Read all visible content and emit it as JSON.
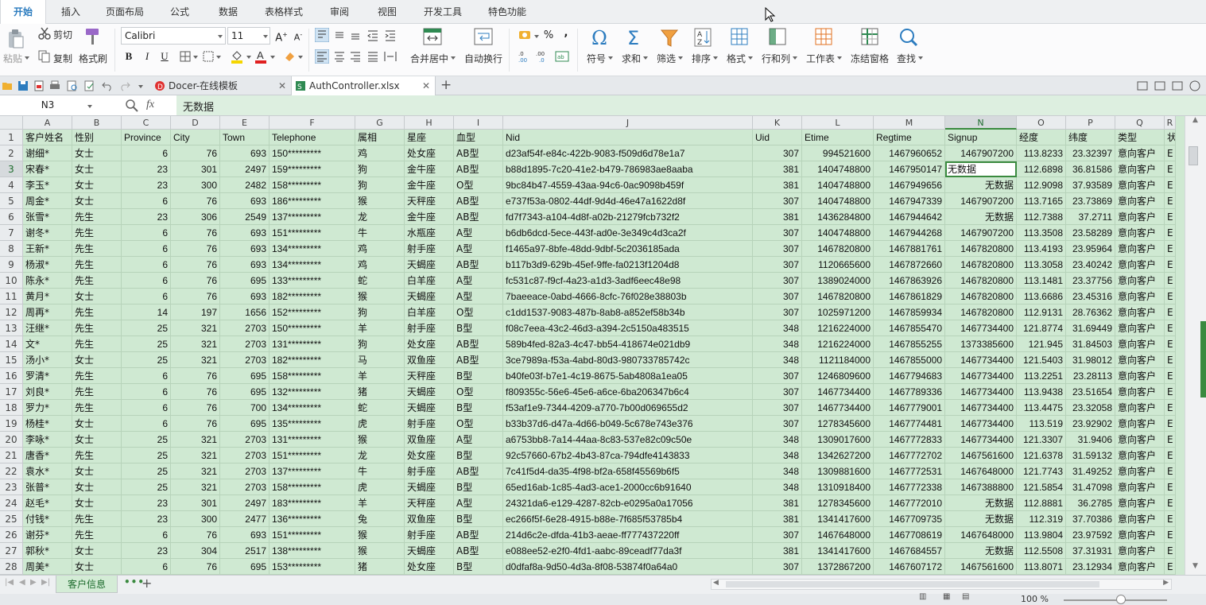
{
  "ribbon_tabs": [
    "开始",
    "插入",
    "页面布局",
    "公式",
    "数据",
    "表格样式",
    "审阅",
    "视图",
    "开发工具",
    "特色功能"
  ],
  "clipboard": {
    "paste": "粘贴",
    "cut": "剪切",
    "copy": "复制",
    "format_painter": "格式刷"
  },
  "font": {
    "name": "Calibri",
    "size": "11"
  },
  "align": {
    "merge_center": "合并居中",
    "wrap": "自动换行"
  },
  "number": {
    "percent": "%",
    "thousands": ","
  },
  "tools": {
    "symbol": "符号",
    "sum": "求和",
    "filter": "筛选",
    "sort": "排序",
    "format": "格式",
    "rows_cols": "行和列",
    "sheet": "工作表",
    "freeze": "冻结窗格",
    "find": "查找"
  },
  "doc_tabs": [
    "Docer-在线模板",
    "AuthController.xlsx"
  ],
  "formula_bar": {
    "cell_ref": "N3",
    "fx": "fx",
    "value": "无数据"
  },
  "columns": [
    "A",
    "B",
    "C",
    "D",
    "E",
    "F",
    "G",
    "H",
    "I",
    "J",
    "K",
    "L",
    "M",
    "N",
    "O",
    "P",
    "Q",
    "R"
  ],
  "header_row": [
    "客户姓名",
    "性别",
    "Province",
    "City",
    "Town",
    "Telephone",
    "属相",
    "星座",
    "血型",
    "Nid",
    "Uid",
    "Etime",
    "Regtime",
    "Signup",
    "经度",
    "纬度",
    "类型",
    "状"
  ],
  "rows": [
    [
      "谢细*",
      "女士",
      "6",
      "76",
      "693",
      "150*********",
      "鸡",
      "处女座",
      "AB型",
      "d23af54f-e84c-422b-9083-f509d6d78e1a7",
      "307",
      "994521600",
      "1467960652",
      "1467907200",
      "113.8233",
      "23.32397",
      "意向客户",
      "E"
    ],
    [
      "宋春*",
      "女士",
      "23",
      "301",
      "2497",
      "159*********",
      "狗",
      "金牛座",
      "AB型",
      "b88d1895-7c20-41e2-b479-786983ae8aaba",
      "381",
      "1404748800",
      "1467950147",
      "无数据",
      "112.6898",
      "36.81586",
      "意向客户",
      "E"
    ],
    [
      "李玉*",
      "女士",
      "23",
      "300",
      "2482",
      "158*********",
      "狗",
      "金牛座",
      "O型",
      "9bc84b47-4559-43aa-94c6-0ac9098b459f",
      "381",
      "1404748800",
      "1467949656",
      "无数据",
      "112.9098",
      "37.93589",
      "意向客户",
      "E"
    ],
    [
      "周金*",
      "女士",
      "6",
      "76",
      "693",
      "186*********",
      "猴",
      "天秤座",
      "AB型",
      "e737f53a-0802-44df-9d4d-46e47a1622d8f",
      "307",
      "1404748800",
      "1467947339",
      "1467907200",
      "113.7165",
      "23.73869",
      "意向客户",
      "E"
    ],
    [
      "张雪*",
      "先生",
      "23",
      "306",
      "2549",
      "137*********",
      "龙",
      "金牛座",
      "AB型",
      "fd7f7343-a104-4d8f-a02b-21279fcb732f2",
      "381",
      "1436284800",
      "1467944642",
      "无数据",
      "112.7388",
      "37.2711",
      "意向客户",
      "E"
    ],
    [
      "谢冬*",
      "先生",
      "6",
      "76",
      "693",
      "151*********",
      "牛",
      "水瓶座",
      "A型",
      "b6db6dcd-5ece-443f-ad0e-3e349c4d3ca2f",
      "307",
      "1404748800",
      "1467944268",
      "1467907200",
      "113.3508",
      "23.58289",
      "意向客户",
      "E"
    ],
    [
      "王新*",
      "先生",
      "6",
      "76",
      "693",
      "134*********",
      "鸡",
      "射手座",
      "A型",
      "f1465a97-8bfe-48dd-9dbf-5c2036185ada",
      "307",
      "1467820800",
      "1467881761",
      "1467820800",
      "113.4193",
      "23.95964",
      "意向客户",
      "E"
    ],
    [
      "杨淑*",
      "先生",
      "6",
      "76",
      "693",
      "134*********",
      "鸡",
      "天蝎座",
      "AB型",
      "b117b3d9-629b-45ef-9ffe-fa0213f1204d8",
      "307",
      "1120665600",
      "1467872660",
      "1467820800",
      "113.3058",
      "23.40242",
      "意向客户",
      "E"
    ],
    [
      "陈永*",
      "先生",
      "6",
      "76",
      "695",
      "133*********",
      "蛇",
      "白羊座",
      "A型",
      "fc531c87-f9cf-4a23-a1d3-3adf6eec48e98",
      "307",
      "1389024000",
      "1467863926",
      "1467820800",
      "113.1481",
      "23.37756",
      "意向客户",
      "E"
    ],
    [
      "黄月*",
      "女士",
      "6",
      "76",
      "693",
      "182*********",
      "猴",
      "天蝎座",
      "A型",
      "7baeeace-0abd-4666-8cfc-76f028e38803b",
      "307",
      "1467820800",
      "1467861829",
      "1467820800",
      "113.6686",
      "23.45316",
      "意向客户",
      "E"
    ],
    [
      "周再*",
      "先生",
      "14",
      "197",
      "1656",
      "152*********",
      "狗",
      "白羊座",
      "O型",
      "c1dd1537-9083-487b-8ab8-a852ef58b34b",
      "307",
      "1025971200",
      "1467859934",
      "1467820800",
      "112.9131",
      "28.76362",
      "意向客户",
      "E"
    ],
    [
      "汪继*",
      "先生",
      "25",
      "321",
      "2703",
      "150*********",
      "羊",
      "射手座",
      "B型",
      "f08c7eea-43c2-46d3-a394-2c5150a483515",
      "348",
      "1216224000",
      "1467855470",
      "1467734400",
      "121.8774",
      "31.69449",
      "意向客户",
      "E"
    ],
    [
      "文*",
      "先生",
      "25",
      "321",
      "2703",
      "131*********",
      "狗",
      "处女座",
      "AB型",
      "589b4fed-82a3-4c47-bb54-418674e021db9",
      "348",
      "1216224000",
      "1467855255",
      "1373385600",
      "121.945",
      "31.84503",
      "意向客户",
      "E"
    ],
    [
      "汤小*",
      "女士",
      "25",
      "321",
      "2703",
      "182*********",
      "马",
      "双鱼座",
      "AB型",
      "3ce7989a-f53a-4abd-80d3-980733785742c",
      "348",
      "1121184000",
      "1467855000",
      "1467734400",
      "121.5403",
      "31.98012",
      "意向客户",
      "E"
    ],
    [
      "罗清*",
      "先生",
      "6",
      "76",
      "695",
      "158*********",
      "羊",
      "天秤座",
      "B型",
      "b40fe03f-b7e1-4c19-8675-5ab4808a1ea05",
      "307",
      "1246809600",
      "1467794683",
      "1467734400",
      "113.2251",
      "23.28113",
      "意向客户",
      "E"
    ],
    [
      "刘良*",
      "先生",
      "6",
      "76",
      "695",
      "132*********",
      "猪",
      "天蝎座",
      "O型",
      "f809355c-56e6-45e6-a6ce-6ba206347b6c4",
      "307",
      "1467734400",
      "1467789336",
      "1467734400",
      "113.9438",
      "23.51654",
      "意向客户",
      "E"
    ],
    [
      "罗力*",
      "先生",
      "6",
      "76",
      "700",
      "134*********",
      "蛇",
      "天蝎座",
      "B型",
      "f53af1e9-7344-4209-a770-7b00d069655d2",
      "307",
      "1467734400",
      "1467779001",
      "1467734400",
      "113.4475",
      "23.32058",
      "意向客户",
      "E"
    ],
    [
      "杨桂*",
      "女士",
      "6",
      "76",
      "695",
      "135*********",
      "虎",
      "射手座",
      "O型",
      "b33b37d6-d47a-4d66-b049-5c678e743e376",
      "307",
      "1278345600",
      "1467774481",
      "1467734400",
      "113.519",
      "23.92902",
      "意向客户",
      "E"
    ],
    [
      "李咏*",
      "女士",
      "25",
      "321",
      "2703",
      "131*********",
      "猴",
      "双鱼座",
      "A型",
      "a6753bb8-7a14-44aa-8c83-537e82c09c50e",
      "348",
      "1309017600",
      "1467772833",
      "1467734400",
      "121.3307",
      "31.9406",
      "意向客户",
      "E"
    ],
    [
      "唐香*",
      "先生",
      "25",
      "321",
      "2703",
      "151*********",
      "龙",
      "处女座",
      "B型",
      "92c57660-67b2-4b43-87ca-794dfe4143833",
      "348",
      "1342627200",
      "1467772702",
      "1467561600",
      "121.6378",
      "31.59132",
      "意向客户",
      "E"
    ],
    [
      "袁水*",
      "女士",
      "25",
      "321",
      "2703",
      "137*********",
      "牛",
      "射手座",
      "AB型",
      "7c41f5d4-da35-4f98-bf2a-658f45569b6f5",
      "348",
      "1309881600",
      "1467772531",
      "1467648000",
      "121.7743",
      "31.49252",
      "意向客户",
      "E"
    ],
    [
      "张普*",
      "女士",
      "25",
      "321",
      "2703",
      "158*********",
      "虎",
      "天蝎座",
      "B型",
      "65ed16ab-1c85-4ad3-ace1-2000cc6b91640",
      "348",
      "1310918400",
      "1467772338",
      "1467388800",
      "121.5854",
      "31.47098",
      "意向客户",
      "E"
    ],
    [
      "赵毛*",
      "女士",
      "23",
      "301",
      "2497",
      "183*********",
      "羊",
      "天秤座",
      "A型",
      "24321da6-e129-4287-82cb-e0295a0a17056",
      "381",
      "1278345600",
      "1467772010",
      "无数据",
      "112.8881",
      "36.2785",
      "意向客户",
      "E"
    ],
    [
      "付钱*",
      "先生",
      "23",
      "300",
      "2477",
      "136*********",
      "兔",
      "双鱼座",
      "B型",
      "ec266f5f-6e28-4915-b88e-7f685f53785b4",
      "381",
      "1341417600",
      "1467709735",
      "无数据",
      "112.319",
      "37.70386",
      "意向客户",
      "E"
    ],
    [
      "谢芬*",
      "先生",
      "6",
      "76",
      "693",
      "151*********",
      "猴",
      "射手座",
      "AB型",
      "214d6c2e-dfda-41b3-aeae-ff777437220ff",
      "307",
      "1467648000",
      "1467708619",
      "1467648000",
      "113.9804",
      "23.97592",
      "意向客户",
      "E"
    ],
    [
      "郭秋*",
      "女士",
      "23",
      "304",
      "2517",
      "138*********",
      "猴",
      "天蝎座",
      "AB型",
      "e088ee52-e2f0-4fd1-aabc-89ceadf77da3f",
      "381",
      "1341417600",
      "1467684557",
      "无数据",
      "112.5508",
      "37.31931",
      "意向客户",
      "E"
    ],
    [
      "周美*",
      "女士",
      "6",
      "76",
      "695",
      "153*********",
      "猪",
      "处女座",
      "B型",
      "d0dfaf8a-9d50-4d3a-8f08-53874f0a64a0",
      "307",
      "1372867200",
      "1467607172",
      "1467561600",
      "113.8071",
      "23.12934",
      "意向客户",
      "E"
    ]
  ],
  "sheet_tabs": [
    "客户信息"
  ],
  "status": {
    "zoom": "100 %"
  },
  "colors": {
    "accent": "#2c7cbf",
    "grid_fill": "#cfe9d2",
    "selection": "#3a8a3f"
  }
}
